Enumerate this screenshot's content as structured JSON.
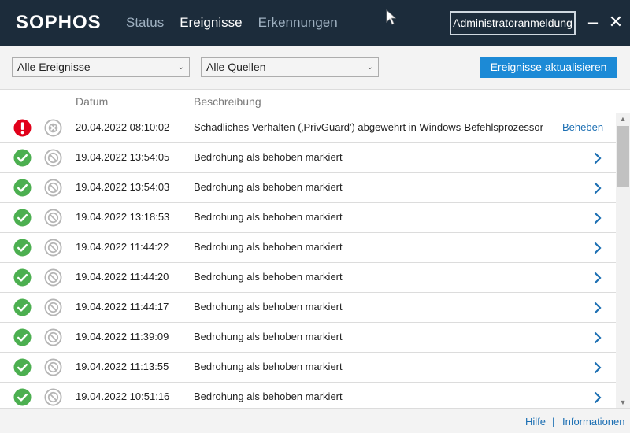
{
  "header": {
    "logo": "SOPHOS",
    "tabs": [
      {
        "label": "Status",
        "active": false
      },
      {
        "label": "Ereignisse",
        "active": true
      },
      {
        "label": "Erkennungen",
        "active": false
      }
    ],
    "admin_button": "Administratoranmeldung",
    "minimize": "–",
    "close": "✕"
  },
  "toolbar": {
    "filter_events": "Alle Ereignisse",
    "filter_sources": "Alle Quellen",
    "refresh_button": "Ereignisse aktualisieren"
  },
  "columns": {
    "date": "Datum",
    "description": "Beschreibung"
  },
  "events": [
    {
      "status": "error",
      "date": "20.04.2022 08:10:02",
      "description": "Schädliches Verhalten (‚PrivGuard') abgewehrt in Windows-Befehlsprozessor",
      "action": "Beheben"
    },
    {
      "status": "ok",
      "date": "19.04.2022 13:54:05",
      "description": "Bedrohung als behoben markiert",
      "action": ""
    },
    {
      "status": "ok",
      "date": "19.04.2022 13:54:03",
      "description": "Bedrohung als behoben markiert",
      "action": ""
    },
    {
      "status": "ok",
      "date": "19.04.2022 13:18:53",
      "description": "Bedrohung als behoben markiert",
      "action": ""
    },
    {
      "status": "ok",
      "date": "19.04.2022 11:44:22",
      "description": "Bedrohung als behoben markiert",
      "action": ""
    },
    {
      "status": "ok",
      "date": "19.04.2022 11:44:20",
      "description": "Bedrohung als behoben markiert",
      "action": ""
    },
    {
      "status": "ok",
      "date": "19.04.2022 11:44:17",
      "description": "Bedrohung als behoben markiert",
      "action": ""
    },
    {
      "status": "ok",
      "date": "19.04.2022 11:39:09",
      "description": "Bedrohung als behoben markiert",
      "action": ""
    },
    {
      "status": "ok",
      "date": "19.04.2022 11:13:55",
      "description": "Bedrohung als behoben markiert",
      "action": ""
    },
    {
      "status": "ok",
      "date": "19.04.2022 10:51:16",
      "description": "Bedrohung als behoben markiert",
      "action": ""
    }
  ],
  "footer": {
    "help": "Hilfe",
    "separator": "|",
    "info": "Informationen"
  },
  "colors": {
    "header_bg": "#1c2c3b",
    "accent": "#1c8ad6",
    "error": "#e1001a",
    "ok": "#4caf50",
    "link": "#1c6fb3"
  }
}
